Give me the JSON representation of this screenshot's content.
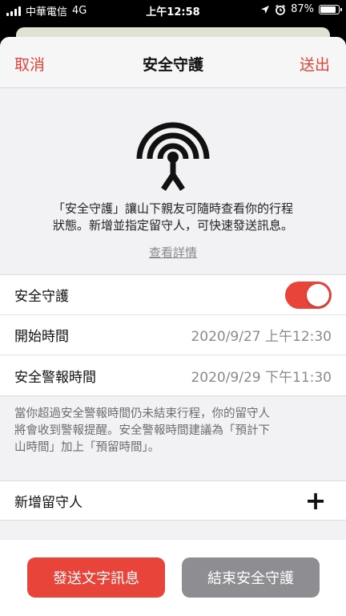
{
  "status_bar": {
    "carrier": "中華電信",
    "network": "4G",
    "time": "上午12:58",
    "battery": "87%",
    "battery_level": 0.87,
    "icons": [
      "signal-icon",
      "location-arrow-icon",
      "alarm-icon",
      "battery-icon"
    ]
  },
  "nav": {
    "cancel": "取消",
    "title": "安全守護",
    "send": "送出"
  },
  "hero": {
    "icon": "broadcast-antenna-icon",
    "line1": "「安全守護」讓山下親友可隨時查看你的行程",
    "line2": "狀態。新增並指定留守人，可快速發送訊息。",
    "details_link": "查看詳情"
  },
  "settings": {
    "guard_label": "安全守護",
    "guard_on": true,
    "start_label": "開始時間",
    "start_value": "2020/9/27 上午12:30",
    "alert_label": "安全警報時間",
    "alert_value": "2020/9/29 下午11:30"
  },
  "note": {
    "line1": "當你超過安全警報時間仍未結束行程，你的留守人",
    "line2": "將會收到警報提醒。安全警報時間建議為「預計下",
    "line3": "山時間」加上「預留時間」。"
  },
  "add_guardian": {
    "label": "新增留守人",
    "icon": "plus-icon",
    "symbol": "+"
  },
  "footer": {
    "send_sms": "發送文字訊息",
    "end_guard": "結束安全守護"
  },
  "colors": {
    "accent": "#e8443a",
    "secondary_button": "#8e8e92",
    "background": "#f2f2f4"
  }
}
